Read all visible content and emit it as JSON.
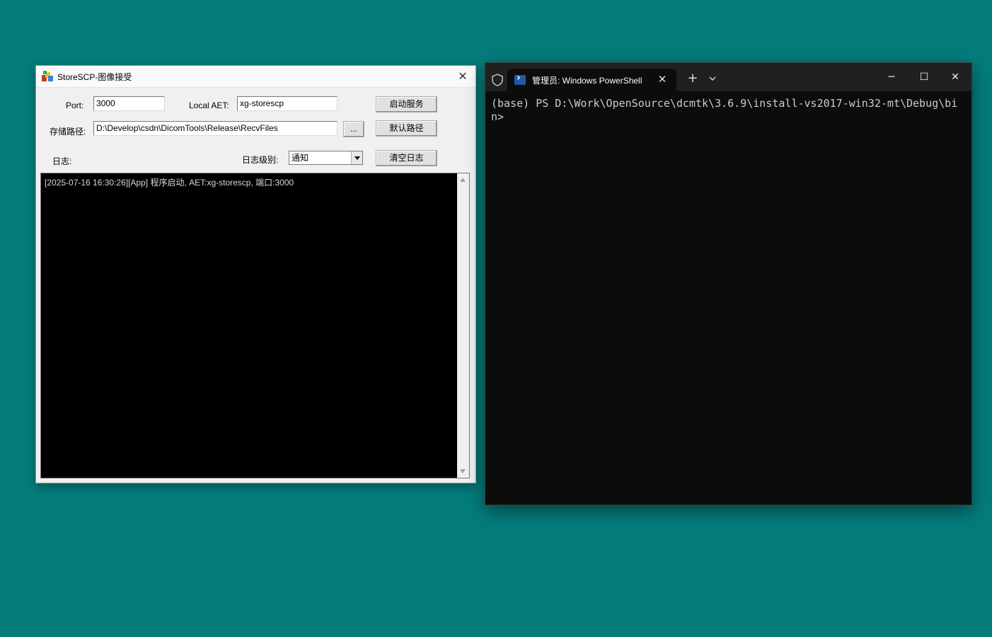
{
  "storescp": {
    "title": "StoreSCP-图像接受",
    "close_glyph": "✕",
    "port_label": "Port:",
    "port_value": "3000",
    "aet_label": "Local AET:",
    "aet_value": "xg-storescp",
    "start_button": "启动服务",
    "path_label": "存储路径:",
    "path_value": "D:\\Develop\\csdn\\DicomTools\\Release\\RecvFiles",
    "browse_button": "...",
    "default_path_button": "默认路径",
    "log_label": "日志:",
    "log_level_label": "日志级别:",
    "log_level_value": "通知",
    "clear_log_button": "清空日志",
    "log_lines": [
      "[2025-07-16 16:30:26][App] 程序启动, AET:xg-storescp, 端口:3000"
    ]
  },
  "terminal": {
    "tab_title": "管理员: Windows PowerShell",
    "tab_close_glyph": "✕",
    "new_tab_glyph": "+",
    "minimize_glyph": "─",
    "maximize_glyph": "☐",
    "close_glyph": "✕",
    "content": "(base) PS D:\\Work\\OpenSource\\dcmtk\\3.6.9\\install-vs2017-win32-mt\\Debug\\bin>",
    "background": "#0c0c0c",
    "text_color": "#cccccc"
  },
  "desktop": {
    "background": "#047c7c"
  }
}
